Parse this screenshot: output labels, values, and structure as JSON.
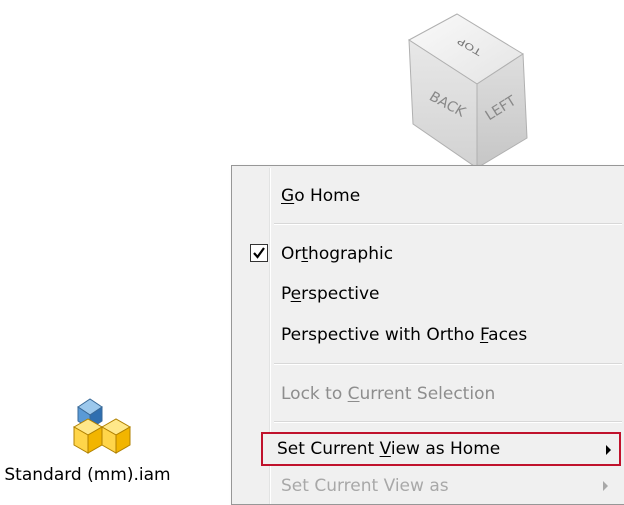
{
  "viewcube": {
    "faces": {
      "top": "TOP",
      "back": "BACK",
      "left": "LEFT"
    }
  },
  "desktop": {
    "file": {
      "label": "Standard (mm).iam",
      "icon": "inventor-assembly-icon"
    }
  },
  "context_menu": {
    "items": [
      {
        "pre": "",
        "key": "G",
        "post": "o Home",
        "state": "enabled"
      },
      {
        "pre": "Or",
        "key": "t",
        "post": "hographic",
        "state": "enabled",
        "checked": true
      },
      {
        "pre": "P",
        "key": "e",
        "post": "rspective",
        "state": "enabled"
      },
      {
        "pre": "Perspective with Ortho ",
        "key": "F",
        "post": "aces",
        "state": "enabled"
      },
      {
        "pre": "Lock to ",
        "key": "C",
        "post": "urrent Selection",
        "state": "disabled"
      },
      {
        "pre": "Set Current ",
        "key": "V",
        "post": "iew as Home",
        "state": "enabled",
        "submenu": true,
        "highlighted": true
      },
      {
        "pre": "Set Current View as",
        "key": "",
        "post": "",
        "state": "disabled",
        "submenu": true
      }
    ]
  },
  "colors": {
    "menu_bg": "#f0f0f0",
    "highlight_border": "#c0122c",
    "disabled_text": "#8d8d8d"
  }
}
